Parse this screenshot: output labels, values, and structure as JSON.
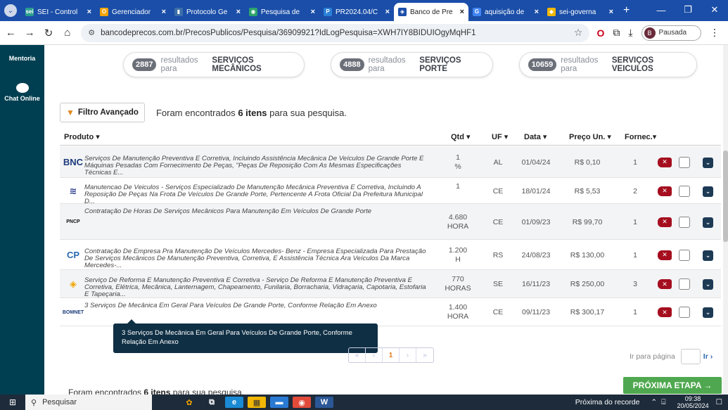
{
  "browser": {
    "tabs": [
      {
        "icon": "sei",
        "label": "SEI - Control",
        "color": "#2a9d8f"
      },
      {
        "icon": "O",
        "label": "Gerenciador",
        "color": "#f4a300"
      },
      {
        "icon": "▮",
        "label": "Protocolo Ge",
        "color": "#3c6ea8"
      },
      {
        "icon": "◉",
        "label": "Pesquisa de",
        "color": "#2aa36b"
      },
      {
        "icon": "P",
        "label": "PR2024.04/C",
        "color": "#2b7fd6"
      },
      {
        "icon": "◈",
        "label": "Banco de Pre",
        "color": "#1a4ea8"
      },
      {
        "icon": "G",
        "label": "aquisição de",
        "color": "#4285f4"
      },
      {
        "icon": "◆",
        "label": "sei-governa",
        "color": "#f2b705"
      }
    ],
    "url": "bancodeprecos.com.br/PrecosPublicos/Pesquisa/36909921?IdLogPesquisa=XWH7IY8BIDUIOgyMqHF1",
    "profile_letter": "B",
    "profile_status": "Pausada"
  },
  "sidebar": {
    "item1": "Mentoria",
    "item2": "Chat Online"
  },
  "pills": [
    {
      "count": "2887",
      "text": "resultados para",
      "term": "SERVIÇOS MECÂNICOS"
    },
    {
      "count": "4888",
      "text": "resultados para",
      "term": "SERVIÇOS PORTE"
    },
    {
      "count": "10659",
      "text": "resultados para",
      "term": "SERVIÇOS VEICULOS"
    }
  ],
  "filter": {
    "label": "Filtro Avançado",
    "found_pre": "Foram encontrados",
    "found_count": "6 itens",
    "found_post": "para sua pesquisa."
  },
  "headers": {
    "produto": "Produto ▾",
    "qtd": "Qtd ▾",
    "uf": "UF ▾",
    "data": "Data ▾",
    "preco": "Preço Un. ▾",
    "fornec": "Fornec.▾"
  },
  "rows": [
    {
      "logo": "BNC",
      "logo_color": "#1b3a7a",
      "produto": "Serviços De Manutenção Preventiva E Corretiva, Incluindo Assistência Mecânica De Veículos De Grande Porte E Máquinas Pesadas Com Fornecimento De Peças, \"Peças De Reposição Com As Mesmas Especificações Técnicas E...",
      "qtd": "1",
      "unidade": "%",
      "uf": "AL",
      "data": "01/04/24",
      "preco": "R$ 0,10",
      "fornec": "1"
    },
    {
      "logo": "≋",
      "logo_color": "#2c3e8c",
      "produto": "Manutencao De Veiculos - Serviços Especializado De Manutenção Mecânica Preventiva E Corretiva, Incluindo A Reposição De Peças Na Frota De Veículos De Grande Porte, Pertencente A Frota Oficial Da Prefeitura Municipal D...",
      "qtd": "1",
      "unidade": "",
      "uf": "CE",
      "data": "18/01/24",
      "preco": "R$ 5,53",
      "fornec": "2"
    },
    {
      "logo": "PNCP",
      "logo_color": "#111",
      "produto": "Contratação De Horas De Serviços Mecânicos Para Manutenção Em Veículos De Grande Porte",
      "qtd": "4.680",
      "unidade": "HORA",
      "uf": "CE",
      "data": "01/09/23",
      "preco": "R$ 99,70",
      "fornec": "1"
    },
    {
      "logo": "CP",
      "logo_color": "#2a6ab0",
      "produto": "Contratação De Empresa Pra Manutenção De Veículos Mercedes- Benz - Empresa Especializada Para Prestação De Serviços Mecânicos De Manutenção Preventiva, Corretiva, E Assistência Técnica Ara Veículos Da Marca Mercedes-...",
      "qtd": "1.200",
      "unidade": "H",
      "uf": "RS",
      "data": "24/08/23",
      "preco": "R$ 130,00",
      "fornec": "1"
    },
    {
      "logo": "◈",
      "logo_color": "#f0a500",
      "produto": "Serviço De Reforma E Manutenção Preventiva E Corretiva - Serviço De Reforma E Manutenção Preventiva E Corretiva, Elétrica, Mecânica, Lanternagem, Chapeamento, Funilaria, Borracharia, Vidraçaria, Capotaria, Estofaria E Tapeçaria...",
      "qtd": "770",
      "unidade": "HORAS",
      "uf": "SE",
      "data": "16/11/23",
      "preco": "R$ 250,00",
      "fornec": "3"
    },
    {
      "logo": "BOMNET",
      "logo_color": "#1b3a7a",
      "produto": "3 Serviços De Mecânica Em Geral Para Veículos De Grande Porte, Conforme Relação Em Anexo",
      "qtd": "1.400",
      "unidade": "HORA",
      "uf": "CE",
      "data": "09/11/23",
      "preco": "R$ 300,17",
      "fornec": "1"
    }
  ],
  "tooltip": "3 Serviços De Mecânica Em Geral Para Veículos De Grande Porte, Conforme Relação Em Anexo",
  "pager": {
    "first": "«",
    "prev": "‹",
    "page": "1",
    "next": "›",
    "last": "»"
  },
  "goto": {
    "label": "Ir para página",
    "button": "Ir ›"
  },
  "footer": {
    "found_pre": "Foram encontrados",
    "found_count": "6 itens",
    "found_post": "para sua pesquisa.",
    "next_step": "PRÓXIMA ETAPA →"
  },
  "taskbar": {
    "search": "Pesquisar",
    "recorder": "Próxima do recorde",
    "time": "09:38",
    "date": "20/05/2024"
  }
}
